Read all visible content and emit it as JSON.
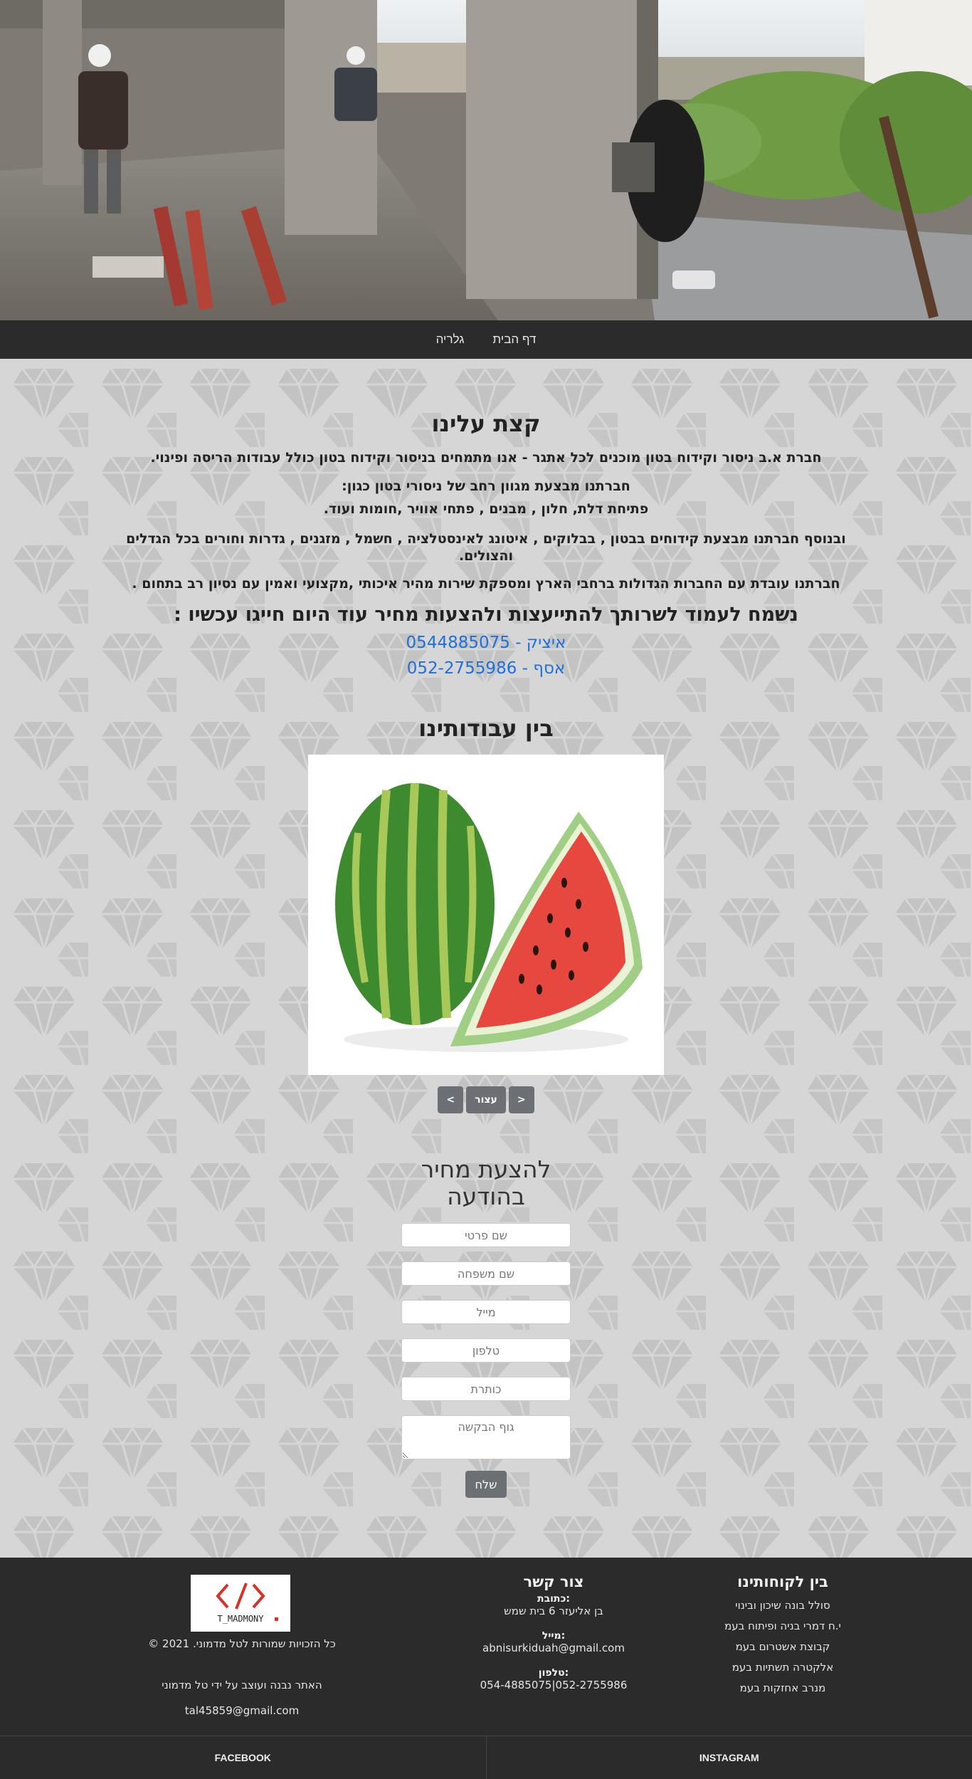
{
  "nav": {
    "items": [
      {
        "label": "דף הבית"
      },
      {
        "label": "גלריה"
      }
    ]
  },
  "about": {
    "title": "קצת עלינו",
    "p1": "חברת א.ב ניסור וקידוח בטון מוכנים לכל אתגר - אנו מתמחים בניסור וקידוח בטון כולל עבודות הריסה ופינוי.",
    "p2": "חברתנו מבצעת מגוון רחב של ניסורי בטון כגון:",
    "p3": "פתיחת דלת, חלון , מבנים , פתחי אוויר ,חומות ועוד.",
    "p4": "ובנוסף חברתנו מבצעת קידוחים בבטון , בבלוקים , איטונג לאינסטלציה , חשמל , מזגנים , גדרות וחורים בכל הגדלים והצולים.",
    "p5": "חברתנו עובדת עם החברות הגדולות ברחבי הארץ ומספקת שירות מהיר איכותי ,מקצועי ואמין עם נסיון רב בתחום .",
    "cta": "נשמח לעמוד לשרותך להתייעצות ולהצעות מחיר עוד היום חייגו עכשיו :",
    "phone1": "איציק - 0544885075",
    "phone2": "אסף - 052-2755986"
  },
  "gallery": {
    "title": "בין עבודותינו",
    "prev": "<",
    "stop": "עצור",
    "next": ">"
  },
  "form": {
    "title_line1": "להצעת מחיר",
    "title_line2": "בהודעה",
    "first_name": "שם פרטי",
    "last_name": "שם משפחה",
    "email": "מייל",
    "phone": "טלפון",
    "subject": "כותרת",
    "body": "גוף הבקשה",
    "submit": "שלח"
  },
  "footer": {
    "clients_title": "בין לקוחותינו",
    "clients": [
      "סולל בונה שיכון ובינוי",
      "י.ח דמרי בניה ופיתוח בעמ",
      "קבוצת אשטרום בעמ",
      "אלקטרה תשתיות בעמ",
      "מנרב אחזקות בעמ"
    ],
    "contact_title": "צור קשר",
    "address_label": ":כתובת",
    "address": "בן אליעזר 6 בית שמש",
    "mail_label": ":מייל",
    "mail": "abnisurkiduah@gmail.com",
    "phone_label": ":טלפון",
    "phones": "052-2755986|054-4885075",
    "logo_text": "T_MADMONY",
    "copyright": "כל הזכויות שמורות לטל מדמוני.  2021 ©",
    "credit": "האתר נבנה ועוצב על ידי טל מדמוני",
    "credit_mail": "tal45859@gmail.com"
  },
  "social": {
    "facebook": "FACEBOOK",
    "instagram": "INSTAGRAM"
  }
}
